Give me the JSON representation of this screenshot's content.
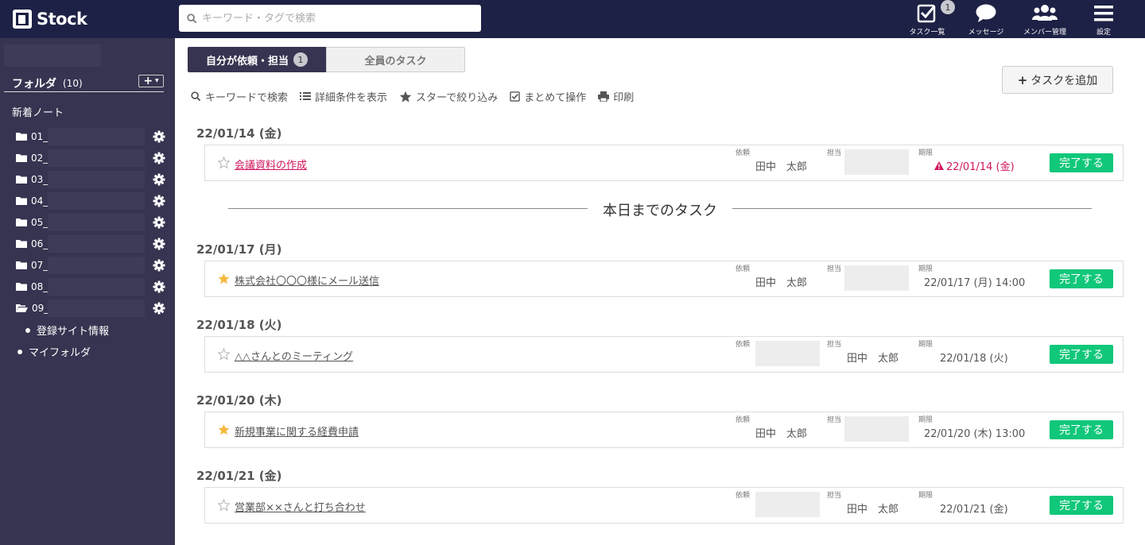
{
  "app": {
    "name": "Stock"
  },
  "search": {
    "placeholder": "キーワード・タグで検索"
  },
  "nav": {
    "tasks": {
      "label": "タスク一覧",
      "badge": "1"
    },
    "messages": {
      "label": "メッセージ"
    },
    "members": {
      "label": "メンバー管理"
    },
    "settings": {
      "label": "設定"
    }
  },
  "sidebar": {
    "folder_title": "フォルダ",
    "folder_count": "(10)",
    "add_label": "+",
    "new_notes": "新着ノート",
    "folders": [
      {
        "name": "01_",
        "open": false
      },
      {
        "name": "02_",
        "open": false
      },
      {
        "name": "03_",
        "open": false
      },
      {
        "name": "04_",
        "open": false
      },
      {
        "name": "05_",
        "open": false
      },
      {
        "name": "06_",
        "open": false
      },
      {
        "name": "07_",
        "open": false
      },
      {
        "name": "08_",
        "open": false
      },
      {
        "name": "09_",
        "open": true
      }
    ],
    "subfolder": "登録サイト情報",
    "my_folder": "マイフォルダ"
  },
  "tabs": {
    "mine": {
      "label": "自分が依頼・担当",
      "badge": "1"
    },
    "all": {
      "label": "全員のタスク"
    }
  },
  "add_task_label": "タスクを追加",
  "toolbar": {
    "keyword_search": "キーワードで検索",
    "advanced": "詳細条件を表示",
    "star_filter": "スターで絞り込み",
    "bulk": "まとめて操作",
    "print": "印刷"
  },
  "column_labels": {
    "requester": "依頼",
    "assignee": "担当",
    "due": "期限"
  },
  "complete_label": "完了する",
  "divider_label": "本日までのタスク",
  "groups": [
    {
      "date": "22/01/14 (金)",
      "task": {
        "title": "会議資料の作成",
        "starred": false,
        "overdue": true,
        "requester": "田中　太郎",
        "assignee": "",
        "due": "22/01/14 (金)"
      }
    },
    {
      "date": "22/01/17 (月)",
      "task": {
        "title": "株式会社〇〇〇様にメール送信",
        "starred": true,
        "overdue": false,
        "requester": "田中　太郎",
        "assignee": "",
        "due": "22/01/17 (月) 14:00"
      }
    },
    {
      "date": "22/01/18 (火)",
      "task": {
        "title": "△△さんとのミーティング",
        "starred": false,
        "overdue": false,
        "requester": "",
        "assignee": "田中　太郎",
        "due": "22/01/18 (火)"
      }
    },
    {
      "date": "22/01/20 (木)",
      "task": {
        "title": "新規事業に関する経費申請",
        "starred": true,
        "overdue": false,
        "requester": "田中　太郎",
        "assignee": "",
        "due": "22/01/20 (木) 13:00"
      }
    },
    {
      "date": "22/01/21 (金)",
      "task": {
        "title": "営業部××さんと打ち合わせ",
        "starred": false,
        "overdue": false,
        "requester": "",
        "assignee": "田中　太郎",
        "due": "22/01/21 (金)"
      }
    }
  ],
  "colors": {
    "topbar": "#1d2145",
    "sidebar": "#363450",
    "complete": "#10c77a",
    "overdue": "#d0155e",
    "star": "#f5b83d"
  }
}
